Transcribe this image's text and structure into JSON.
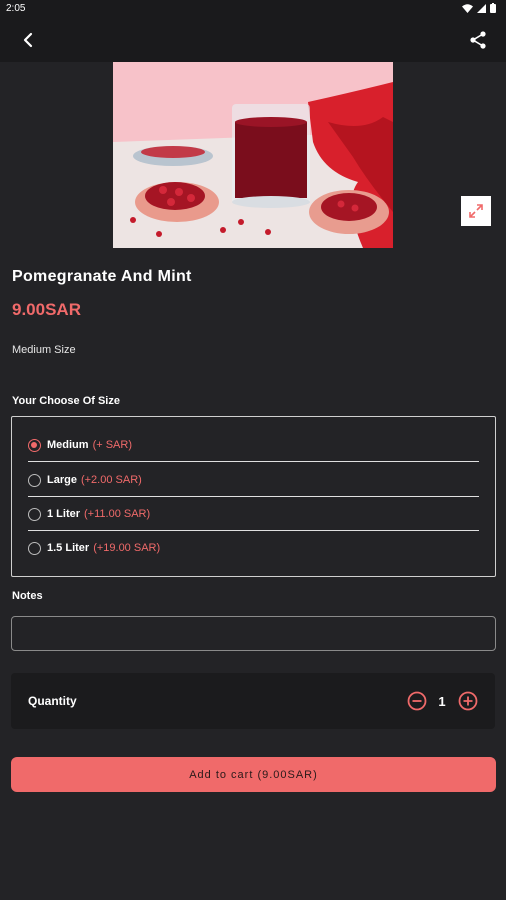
{
  "status_bar": {
    "time": "2:05"
  },
  "product": {
    "name": "Pomegranate And Mint",
    "price": "9.00SAR",
    "description": "Medium Size"
  },
  "size_section": {
    "label": "Your Choose Of Size",
    "options": [
      {
        "name": "Medium",
        "extra": "(+ SAR)",
        "selected": true
      },
      {
        "name": "Large",
        "extra": "(+2.00 SAR)",
        "selected": false
      },
      {
        "name": "1 Liter",
        "extra": "(+11.00 SAR)",
        "selected": false
      },
      {
        "name": "1.5 Liter",
        "extra": "(+19.00 SAR)",
        "selected": false
      }
    ]
  },
  "notes": {
    "label": "Notes",
    "value": "",
    "placeholder": ""
  },
  "quantity": {
    "label": "Quantity",
    "value": "1"
  },
  "cart": {
    "button_label": "Add to cart (9.00SAR)"
  },
  "colors": {
    "accent": "#f06a6a",
    "background": "#232326",
    "bar": "#1a1a1c"
  },
  "icons": {
    "back": "arrow-back-icon",
    "share": "share-icon",
    "expand": "expand-icon",
    "minus": "minus-circle-icon",
    "plus": "plus-circle-icon"
  }
}
